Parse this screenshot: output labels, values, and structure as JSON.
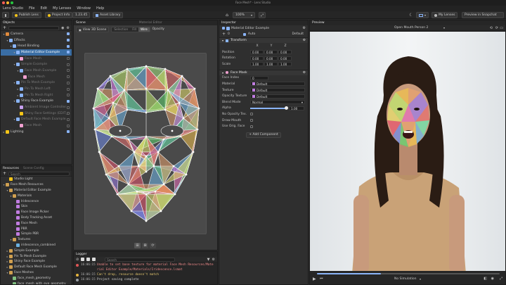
{
  "window": {
    "title": "Face Mesh* - Lens Studio"
  },
  "menu": [
    "Lens Studio",
    "File",
    "Edit",
    "My Lenses",
    "Window",
    "Help"
  ],
  "toolbar": {
    "publish": "Publish Lens",
    "project_info": "Project Info",
    "version": "1.23.45",
    "asset_library": "Asset Library",
    "zoom": "100%",
    "my_lenses": "My Lenses",
    "preview_snapchat": "Preview in Snapchat"
  },
  "objects_panel": {
    "tab": "Objects",
    "items": [
      {
        "label": "Camera",
        "depth": 0,
        "chev": "▾",
        "color": "#e08a3c",
        "selected": false,
        "dim": false,
        "check": true
      },
      {
        "label": "Effects",
        "depth": 1,
        "chev": "▾",
        "color": "#8ab4f8",
        "selected": false,
        "dim": false,
        "check": true
      },
      {
        "label": "Head Binding",
        "depth": 2,
        "chev": "▾",
        "color": "#8ab4f8",
        "selected": false,
        "dim": false,
        "check": true
      },
      {
        "label": "Material Editor Example",
        "depth": 3,
        "chev": "▾",
        "color": "#8ab4f8",
        "selected": true,
        "dim": false,
        "check": true
      },
      {
        "label": "Face Mesh",
        "depth": 4,
        "chev": "",
        "color": "#f0a0d0",
        "selected": false,
        "dim": true,
        "check": false
      },
      {
        "label": "Simple Example",
        "depth": 3,
        "chev": "▾",
        "color": "#8ab4f8",
        "selected": false,
        "dim": true,
        "check": false
      },
      {
        "label": "Face Mesh Example",
        "depth": 4,
        "chev": "▾",
        "color": "#8ab4f8",
        "selected": false,
        "dim": true,
        "check": false
      },
      {
        "label": "Face Mesh",
        "depth": 5,
        "chev": "",
        "color": "#f0a0d0",
        "selected": false,
        "dim": true,
        "check": false
      },
      {
        "label": "Pin To Mesh Example",
        "depth": 3,
        "chev": "▾",
        "color": "#8ab4f8",
        "selected": false,
        "dim": true,
        "check": false
      },
      {
        "label": "Pin To Mesh Left",
        "depth": 4,
        "chev": "▸",
        "color": "#8ab4f8",
        "selected": false,
        "dim": true,
        "check": false
      },
      {
        "label": "Pin To Mesh Right",
        "depth": 4,
        "chev": "▸",
        "color": "#8ab4f8",
        "selected": false,
        "dim": true,
        "check": false
      },
      {
        "label": "Shiny Face Example",
        "depth": 3,
        "chev": "▾",
        "color": "#8ab4f8",
        "selected": false,
        "dim": false,
        "check": true
      },
      {
        "label": "Ambient Image Controller",
        "depth": 4,
        "chev": "",
        "color": "#c8a0f0",
        "selected": false,
        "dim": true,
        "check": false
      },
      {
        "label": "Shiny Face Settings (EDIT_...",
        "depth": 4,
        "chev": "",
        "color": "#f5c518",
        "selected": false,
        "dim": true,
        "check": false
      },
      {
        "label": "Default Face Mesh Example",
        "depth": 3,
        "chev": "▾",
        "color": "#8ab4f8",
        "selected": false,
        "dim": true,
        "check": false
      },
      {
        "label": "Face Mesh",
        "depth": 4,
        "chev": "",
        "color": "#f0a0d0",
        "selected": false,
        "dim": true,
        "check": false
      },
      {
        "label": "Lighting",
        "depth": 0,
        "chev": "▸",
        "color": "#f5c518",
        "selected": false,
        "dim": false,
        "check": true
      }
    ]
  },
  "resources_panel": {
    "tabs": [
      "Resources",
      "Scene Config"
    ],
    "search_placeholder": "Search",
    "items": [
      {
        "label": "Studio Light",
        "depth": 1,
        "chev": "",
        "color": "#f5c518"
      },
      {
        "label": "Face Mesh Resources",
        "depth": 0,
        "chev": "▾",
        "color": "#d0a050"
      },
      {
        "label": "Material Editor Example",
        "depth": 1,
        "chev": "▾",
        "color": "#d0a050"
      },
      {
        "label": "Materials",
        "depth": 2,
        "chev": "▾",
        "color": "#d0a050"
      },
      {
        "label": "Iridescence",
        "depth": 3,
        "chev": "",
        "color": "#c07ce0"
      },
      {
        "label": "Skin",
        "depth": 3,
        "chev": "",
        "color": "#c07ce0"
      },
      {
        "label": "Face Image Picker",
        "depth": 3,
        "chev": "",
        "color": "#c07ce0"
      },
      {
        "label": "Body Tracking Asset",
        "depth": 3,
        "chev": "",
        "color": "#c07ce0"
      },
      {
        "label": "Face Mesh",
        "depth": 3,
        "chev": "",
        "color": "#c07ce0"
      },
      {
        "label": "PBR",
        "depth": 3,
        "chev": "",
        "color": "#c07ce0"
      },
      {
        "label": "Simple PBR",
        "depth": 3,
        "chev": "",
        "color": "#c07ce0"
      },
      {
        "label": "Textures",
        "depth": 2,
        "chev": "▾",
        "color": "#d0a050"
      },
      {
        "label": "iridescence_combined",
        "depth": 3,
        "chev": "",
        "color": "#6ab0e0"
      },
      {
        "label": "Simple Example",
        "depth": 1,
        "chev": "▸",
        "color": "#d0a050"
      },
      {
        "label": "Pin To Mesh Example",
        "depth": 1,
        "chev": "▸",
        "color": "#d0a050"
      },
      {
        "label": "Shiny Face Example",
        "depth": 1,
        "chev": "▸",
        "color": "#d0a050"
      },
      {
        "label": "Default Face Mesh Example",
        "depth": 1,
        "chev": "▸",
        "color": "#d0a050"
      },
      {
        "label": "Face Meshes",
        "depth": 1,
        "chev": "▾",
        "color": "#d0a050"
      },
      {
        "label": "face_mesh_geometry",
        "depth": 2,
        "chev": "",
        "color": "#80c080"
      },
      {
        "label": "face_mesh_with_eye_geometry",
        "depth": 2,
        "chev": "",
        "color": "#80c080"
      }
    ]
  },
  "scene_panel": {
    "tabs": [
      "Scene",
      "Material Editor"
    ],
    "view_button": "View 3D Scene",
    "toggle_options": [
      "Selection",
      "Fill",
      "Wire"
    ],
    "opacity_label": "Opacity"
  },
  "logger": {
    "tab": "Logger",
    "rows": [
      {
        "type": "err",
        "time": "16:06:15",
        "msg": "Unable to set base texture for material Face Mesh Resources/Mate"
      },
      {
        "type": "err",
        "time": "",
        "msg": "rial Editor Example/Materials/Iridescence.lsmat"
      },
      {
        "type": "warn",
        "time": "16:06:15",
        "msg": "Can't drop, resource doesn't match"
      },
      {
        "type": "info",
        "time": "16:06:15",
        "msg": "Project saving complete"
      }
    ],
    "search_placeholder": "Search"
  },
  "inspector": {
    "tab": "Inspector",
    "object_name": "Material Editor Example",
    "layer": "0",
    "auto_label": "Auto",
    "default_label": "Default",
    "transform": {
      "title": "Transform",
      "axes": [
        "X",
        "Y",
        "Z"
      ],
      "rows": [
        {
          "label": "Position",
          "values": [
            "0.00",
            "0.00",
            "0.00"
          ]
        },
        {
          "label": "Rotation",
          "values": [
            "0.00",
            "0.00",
            "0.00"
          ]
        },
        {
          "label": "Scale",
          "values": [
            "1.00",
            "1.00",
            "1.00"
          ]
        }
      ]
    },
    "face_mask": {
      "title": "Face Mask",
      "rows": [
        {
          "label": "Face Index",
          "value": "0"
        },
        {
          "label": "Material",
          "value": "Default"
        },
        {
          "label": "Texture",
          "value": "Default"
        },
        {
          "label": "Opacity Texture",
          "value": "Default"
        },
        {
          "label": "Blend Mode",
          "value": "Normal"
        },
        {
          "label": "Alpha",
          "value": "1.00"
        }
      ],
      "checks": [
        "No Opacity Tex.",
        "Draw Mouth",
        "Use Orig. Face"
      ]
    },
    "add_component": "+ Add Component"
  },
  "preview": {
    "tab": "Preview",
    "mode": "Open Mouth Person 2",
    "simulated": "No Simulation",
    "progress": 0.35
  },
  "colors": {
    "selection": "#3a6ea5",
    "accent_yellow": "#f5c518",
    "accent_blue": "#8ab4f8",
    "panel_bg": "#2f2f2f",
    "preview_bg": "#eef0f1"
  },
  "mesh_colors": [
    "#f2c14e",
    "#e86f6f",
    "#6fb7e8",
    "#9d7ce8",
    "#6be8b0",
    "#e8a36f",
    "#e86fbc",
    "#5fd36f",
    "#e8e06f",
    "#6f8ae8",
    "#c0e86f",
    "#e8556f"
  ]
}
